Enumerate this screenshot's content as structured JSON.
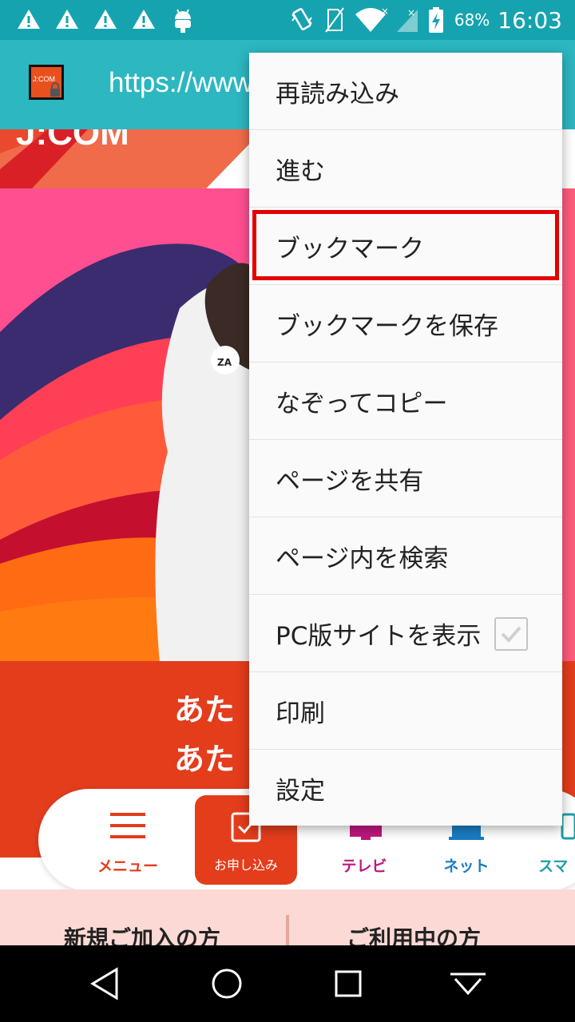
{
  "status_bar": {
    "battery_percent": "68%",
    "time": "16:03"
  },
  "url_bar": {
    "favicon_text": "J:COM",
    "url": "https://www.jcom.co.jp/"
  },
  "page": {
    "logo": "J:COM",
    "headline_line1": "あた",
    "headline_line2": "あた",
    "bottom_nav": {
      "menu_label": "メニュー",
      "apply_label": "お申し込み",
      "tv_label": "テレビ",
      "net_label": "ネット",
      "sma_label": "スマ"
    },
    "tabs": {
      "new_label": "新規ご加入の方",
      "existing_label": "ご利用中の方"
    }
  },
  "menu": {
    "items": [
      {
        "label": "再読み込み"
      },
      {
        "label": "進む"
      },
      {
        "label": "ブックマーク"
      },
      {
        "label": "ブックマークを保存"
      },
      {
        "label": "なぞってコピー"
      },
      {
        "label": "ページを共有"
      },
      {
        "label": "ページ内を検索"
      },
      {
        "label": "PC版サイトを表示",
        "checked": true
      },
      {
        "label": "印刷"
      },
      {
        "label": "設定"
      }
    ]
  },
  "colors": {
    "status_bar": "#16a3b0",
    "url_bar": "#2cb7c1",
    "brand_red": "#e33d1c",
    "highlight_border": "#e30000"
  }
}
